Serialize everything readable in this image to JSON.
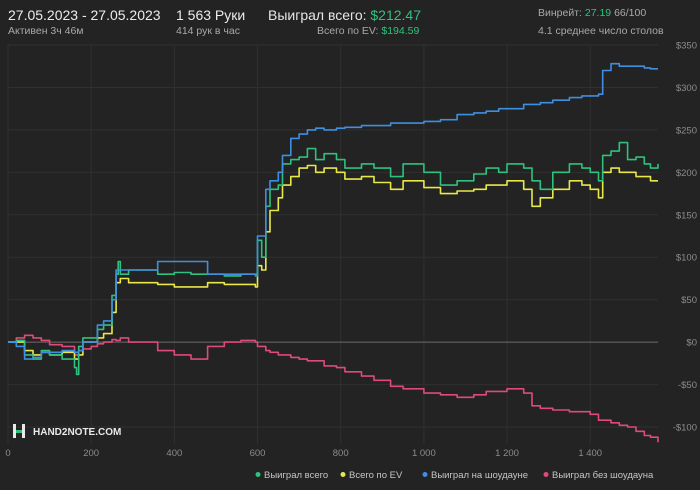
{
  "header": {
    "date_range": "27.05.2023 - 27.05.2023",
    "active_time": "Активен 3ч 46м",
    "hands": "1 563 Руки",
    "hands_per_hour": "414 рук в час",
    "won_total_label": "Выиграл всего:",
    "won_total_value": "$212.47",
    "ev_total_label": "Всего по EV:",
    "ev_total_value": "$194.59",
    "winrate_label": "Винрейт:",
    "winrate_value": "27.19",
    "winrate_unit": "66/100",
    "avg_tables": "4.1 среднее число столов"
  },
  "logo": {
    "text": "HAND2NOTE.COM"
  },
  "colors": {
    "won_total": "#2ec27e",
    "ev_total": "#e8e84a",
    "showdown": "#3f8fe0",
    "non_showdown": "#e04a78",
    "background": "#232323",
    "grid": "#303030"
  },
  "chart_data": {
    "type": "line",
    "xlabel": "",
    "ylabel": "",
    "xlim": [
      0,
      1563
    ],
    "ylim": [
      -120,
      350
    ],
    "x_ticks": [
      0,
      200,
      400,
      600,
      800,
      1000,
      1200,
      1400
    ],
    "x_tick_labels": [
      "0",
      "200",
      "400",
      "600",
      "800",
      "1 000",
      "1 200",
      "1 400"
    ],
    "y_ticks": [
      -100,
      -50,
      0,
      50,
      100,
      150,
      200,
      250,
      300,
      350
    ],
    "y_tick_labels": [
      "-$100",
      "-$50",
      "$0",
      "$50",
      "$100",
      "$150",
      "$200",
      "$250",
      "$300",
      "$350"
    ],
    "grid": true,
    "legend_position": "bottom",
    "series": [
      {
        "name": "Выиграл всего",
        "color": "#2ec27e",
        "points": [
          [
            0,
            0
          ],
          [
            20,
            2
          ],
          [
            40,
            -15
          ],
          [
            60,
            -20
          ],
          [
            80,
            -10
          ],
          [
            100,
            -15
          ],
          [
            130,
            -20
          ],
          [
            160,
            -30
          ],
          [
            165,
            -38
          ],
          [
            170,
            -5
          ],
          [
            180,
            5
          ],
          [
            200,
            5
          ],
          [
            215,
            15
          ],
          [
            230,
            20
          ],
          [
            250,
            55
          ],
          [
            260,
            80
          ],
          [
            265,
            95
          ],
          [
            270,
            80
          ],
          [
            290,
            85
          ],
          [
            330,
            85
          ],
          [
            360,
            80
          ],
          [
            400,
            82
          ],
          [
            440,
            80
          ],
          [
            480,
            80
          ],
          [
            520,
            78
          ],
          [
            560,
            80
          ],
          [
            595,
            80
          ],
          [
            600,
            120
          ],
          [
            610,
            100
          ],
          [
            620,
            160
          ],
          [
            630,
            180
          ],
          [
            650,
            185
          ],
          [
            660,
            210
          ],
          [
            680,
            215
          ],
          [
            700,
            218
          ],
          [
            720,
            228
          ],
          [
            740,
            215
          ],
          [
            760,
            222
          ],
          [
            790,
            215
          ],
          [
            810,
            205
          ],
          [
            850,
            210
          ],
          [
            880,
            205
          ],
          [
            920,
            195
          ],
          [
            950,
            210
          ],
          [
            1000,
            200
          ],
          [
            1040,
            185
          ],
          [
            1080,
            190
          ],
          [
            1120,
            198
          ],
          [
            1150,
            205
          ],
          [
            1180,
            200
          ],
          [
            1200,
            210
          ],
          [
            1240,
            205
          ],
          [
            1260,
            190
          ],
          [
            1280,
            180
          ],
          [
            1310,
            200
          ],
          [
            1350,
            210
          ],
          [
            1380,
            205
          ],
          [
            1400,
            200
          ],
          [
            1420,
            190
          ],
          [
            1430,
            220
          ],
          [
            1450,
            225
          ],
          [
            1470,
            235
          ],
          [
            1490,
            215
          ],
          [
            1510,
            218
          ],
          [
            1530,
            210
          ],
          [
            1545,
            205
          ],
          [
            1563,
            210
          ]
        ]
      },
      {
        "name": "Всего по EV",
        "color": "#e8e84a",
        "points": [
          [
            0,
            0
          ],
          [
            20,
            0
          ],
          [
            40,
            -10
          ],
          [
            60,
            -15
          ],
          [
            80,
            -12
          ],
          [
            100,
            -15
          ],
          [
            130,
            -12
          ],
          [
            160,
            -20
          ],
          [
            170,
            -15
          ],
          [
            180,
            0
          ],
          [
            200,
            0
          ],
          [
            215,
            5
          ],
          [
            230,
            10
          ],
          [
            250,
            35
          ],
          [
            260,
            70
          ],
          [
            270,
            75
          ],
          [
            290,
            70
          ],
          [
            330,
            70
          ],
          [
            360,
            68
          ],
          [
            400,
            65
          ],
          [
            440,
            65
          ],
          [
            480,
            70
          ],
          [
            520,
            68
          ],
          [
            560,
            68
          ],
          [
            595,
            65
          ],
          [
            600,
            90
          ],
          [
            610,
            85
          ],
          [
            620,
            130
          ],
          [
            630,
            155
          ],
          [
            650,
            170
          ],
          [
            660,
            185
          ],
          [
            680,
            195
          ],
          [
            700,
            205
          ],
          [
            720,
            208
          ],
          [
            740,
            200
          ],
          [
            760,
            205
          ],
          [
            790,
            200
          ],
          [
            810,
            192
          ],
          [
            850,
            195
          ],
          [
            880,
            188
          ],
          [
            920,
            180
          ],
          [
            950,
            190
          ],
          [
            1000,
            182
          ],
          [
            1040,
            175
          ],
          [
            1080,
            178
          ],
          [
            1120,
            180
          ],
          [
            1150,
            185
          ],
          [
            1180,
            185
          ],
          [
            1200,
            190
          ],
          [
            1240,
            180
          ],
          [
            1260,
            160
          ],
          [
            1280,
            170
          ],
          [
            1310,
            180
          ],
          [
            1350,
            190
          ],
          [
            1380,
            185
          ],
          [
            1400,
            180
          ],
          [
            1420,
            170
          ],
          [
            1430,
            200
          ],
          [
            1450,
            205
          ],
          [
            1470,
            200
          ],
          [
            1490,
            200
          ],
          [
            1510,
            195
          ],
          [
            1530,
            195
          ],
          [
            1545,
            190
          ],
          [
            1563,
            190
          ]
        ]
      },
      {
        "name": "Выиграл на шоудауне",
        "color": "#3f8fe0",
        "points": [
          [
            0,
            0
          ],
          [
            20,
            -5
          ],
          [
            40,
            -20
          ],
          [
            60,
            -18
          ],
          [
            80,
            -12
          ],
          [
            100,
            -12
          ],
          [
            130,
            -10
          ],
          [
            160,
            -12
          ],
          [
            170,
            -10
          ],
          [
            180,
            0
          ],
          [
            200,
            0
          ],
          [
            215,
            20
          ],
          [
            230,
            25
          ],
          [
            250,
            50
          ],
          [
            260,
            85
          ],
          [
            270,
            85
          ],
          [
            290,
            85
          ],
          [
            330,
            85
          ],
          [
            360,
            95
          ],
          [
            400,
            95
          ],
          [
            440,
            95
          ],
          [
            480,
            80
          ],
          [
            520,
            80
          ],
          [
            560,
            80
          ],
          [
            595,
            78
          ],
          [
            600,
            125
          ],
          [
            610,
            125
          ],
          [
            620,
            180
          ],
          [
            630,
            190
          ],
          [
            650,
            200
          ],
          [
            660,
            220
          ],
          [
            680,
            240
          ],
          [
            700,
            245
          ],
          [
            720,
            250
          ],
          [
            740,
            252
          ],
          [
            760,
            250
          ],
          [
            790,
            252
          ],
          [
            810,
            253
          ],
          [
            850,
            255
          ],
          [
            880,
            255
          ],
          [
            920,
            258
          ],
          [
            950,
            258
          ],
          [
            1000,
            260
          ],
          [
            1040,
            262
          ],
          [
            1080,
            268
          ],
          [
            1120,
            270
          ],
          [
            1150,
            272
          ],
          [
            1180,
            275
          ],
          [
            1200,
            275
          ],
          [
            1240,
            280
          ],
          [
            1260,
            280
          ],
          [
            1280,
            282
          ],
          [
            1310,
            285
          ],
          [
            1350,
            288
          ],
          [
            1380,
            290
          ],
          [
            1400,
            290
          ],
          [
            1420,
            292
          ],
          [
            1430,
            320
          ],
          [
            1450,
            328
          ],
          [
            1470,
            325
          ],
          [
            1490,
            325
          ],
          [
            1510,
            325
          ],
          [
            1530,
            323
          ],
          [
            1545,
            322
          ],
          [
            1563,
            322
          ]
        ]
      },
      {
        "name": "Выиграл без шоудауна",
        "color": "#e04a78",
        "points": [
          [
            0,
            0
          ],
          [
            20,
            5
          ],
          [
            40,
            8
          ],
          [
            60,
            5
          ],
          [
            80,
            2
          ],
          [
            100,
            -3
          ],
          [
            130,
            -5
          ],
          [
            160,
            -15
          ],
          [
            170,
            -10
          ],
          [
            180,
            -8
          ],
          [
            200,
            -5
          ],
          [
            215,
            -2
          ],
          [
            230,
            0
          ],
          [
            250,
            3
          ],
          [
            260,
            2
          ],
          [
            270,
            5
          ],
          [
            290,
            0
          ],
          [
            330,
            0
          ],
          [
            360,
            -10
          ],
          [
            400,
            -15
          ],
          [
            440,
            -20
          ],
          [
            480,
            -5
          ],
          [
            520,
            0
          ],
          [
            560,
            2
          ],
          [
            595,
            0
          ],
          [
            600,
            -5
          ],
          [
            610,
            -5
          ],
          [
            620,
            -10
          ],
          [
            630,
            -12
          ],
          [
            650,
            -15
          ],
          [
            660,
            -15
          ],
          [
            680,
            -18
          ],
          [
            700,
            -20
          ],
          [
            720,
            -22
          ],
          [
            740,
            -22
          ],
          [
            760,
            -28
          ],
          [
            790,
            -30
          ],
          [
            810,
            -35
          ],
          [
            850,
            -40
          ],
          [
            880,
            -45
          ],
          [
            920,
            -52
          ],
          [
            950,
            -55
          ],
          [
            1000,
            -60
          ],
          [
            1040,
            -62
          ],
          [
            1080,
            -65
          ],
          [
            1120,
            -62
          ],
          [
            1150,
            -58
          ],
          [
            1180,
            -58
          ],
          [
            1200,
            -55
          ],
          [
            1240,
            -60
          ],
          [
            1260,
            -75
          ],
          [
            1280,
            -78
          ],
          [
            1310,
            -80
          ],
          [
            1350,
            -82
          ],
          [
            1380,
            -82
          ],
          [
            1400,
            -85
          ],
          [
            1420,
            -92
          ],
          [
            1430,
            -92
          ],
          [
            1450,
            -95
          ],
          [
            1470,
            -98
          ],
          [
            1490,
            -100
          ],
          [
            1510,
            -105
          ],
          [
            1530,
            -110
          ],
          [
            1545,
            -112
          ],
          [
            1563,
            -118
          ]
        ]
      }
    ]
  }
}
